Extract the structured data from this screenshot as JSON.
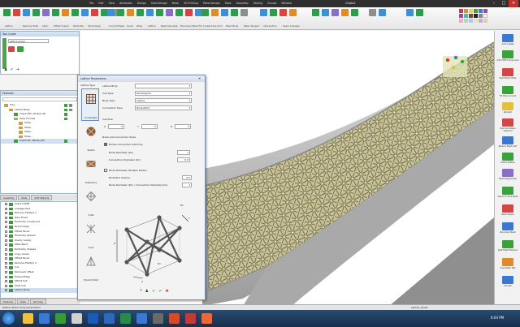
{
  "titlebar": {
    "title": "Chain2",
    "menus": [
      "File",
      "Edit",
      "View",
      "Attributes",
      "Design",
      "Solid Design",
      "Mesh",
      "3D Printing",
      "Metal Design",
      "Tools",
      "Assembly",
      "Tooling",
      "Groups",
      "Window"
    ]
  },
  "tool_guide": {
    "title": "Tool Guide",
    "selector": "Lattice Group"
  },
  "features": {
    "title": "Features",
    "search_placeholder": "Search",
    "items": [
      {
        "label": "Tray",
        "level": 0
      },
      {
        "label": "Lattice Body",
        "level": 1
      },
      {
        "label": "Import BT...Part(s) 3D",
        "level": 2
      },
      {
        "label": "Tube Formed",
        "level": 2
      },
      {
        "label": "Shap...",
        "level": 3
      },
      {
        "label": "Shap...",
        "level": 3
      },
      {
        "label": "Shap...",
        "level": 3
      },
      {
        "label": "Shap...",
        "level": 3
      },
      {
        "label": "Import B...Part(s) 3D",
        "level": 2
      }
    ]
  },
  "panel_tabs": [
    "Assembly",
    "Parts",
    "DOF Wizards"
  ],
  "history": {
    "items": [
      "Import STEP",
      "Lossage Part",
      "Remove Fillet(s) 1",
      "Tube Fixed",
      "Distinctly Conserved",
      "Round edge",
      "Offset Faces",
      "Distinctly Shared",
      "Overly Sub(s)",
      "Plate Bend",
      "Distinctly Shaped",
      "Copy Linear",
      "Offset Faces",
      "Remove Fillet(s) 3",
      "Cut",
      "Removed offset",
      "Extend Edge",
      "Offset Sub",
      "Shell Out",
      "Lattice Body"
    ],
    "tabs": [
      "Features",
      "Data",
      "Set View"
    ]
  },
  "ribbon": {
    "group_labels": [
      "Lattice",
      "Remove Shell",
      "Shell",
      "Offset Scaled",
      "Perforate",
      "Shrinkwrap",
      "Bridge Tool",
      "Extend Edge",
      "Stitch Convert",
      "Flatten",
      "Distance Fit",
      "Measure Tool",
      "Convert Mesh",
      "Quick",
      "Wrap",
      "Lattice",
      "Mesh Visualize",
      "Boundary Mesh Fill",
      "Create Free-form",
      "Mesh Body",
      "Make Tangent",
      "Intersection",
      "Seam Collapse"
    ]
  },
  "dialog": {
    "title": "Lattice Parameters",
    "section_label": "Lattice Type",
    "types": [
      "Uni Strutted",
      "Stretch",
      "Octahedron",
      "Octet",
      "Cross",
      "Pyramid Octet"
    ],
    "fields": [
      {
        "label": "Lattice Body",
        "value": ""
      },
      {
        "label": "Cell Type",
        "value": "Rectangular"
      },
      {
        "label": "Body Type",
        "value": "Lattice"
      },
      {
        "label": "Connection Type",
        "value": "Node/Strut"
      }
    ],
    "cell_size": {
      "label": "Cell Size",
      "x_label": "X",
      "x": "5",
      "y_label": "Y",
      "y": "5",
      "z_label": "Z",
      "z": "5"
    },
    "node_section": "Node and Connection Sizes",
    "node_check_label": "Nodes Connected Uniformly",
    "node_diameter_label": "Node Diameter (Dn)",
    "node_diameter": "1",
    "conn_diameter_label": "Connection Diameter (Dc)",
    "conn_diameter": "0.5",
    "surface_check_label": "Node Diameter Variable Radius",
    "half_label": "Node/Full Volume",
    "half_value": "0.5",
    "ratio_label": "Node Diameter (Dn) / Connection Diameter (Dc)",
    "ratio_value": "1",
    "diagram_labels": {
      "d1": "Dn",
      "d2": "Dc",
      "x": "X",
      "y": "Y",
      "z": "Z"
    }
  },
  "right_toolbar": {
    "labels": [
      "Auto Create",
      "Add STEP Component",
      "Shell Body Utility",
      "Fill Hole Convert",
      "Remesh",
      "Remove Spikes Selected",
      "Reduce Mesh Surf",
      "Lattice Pattern",
      "Mesh Regenerate",
      "Select Tri Face Mesh",
      "Mesh Repair",
      "Boundary Mesh",
      "Split Mesh Element",
      "Save Mesh Plat",
      "Smooth"
    ]
  },
  "status": {
    "left": "Define lattice body parameters",
    "right": "Lattice_shell1"
  },
  "taskbar": {
    "time": "6:04 PM"
  },
  "colors": {
    "ribbon_bg": "#efefef",
    "dialog_bg": "#f3f3f3",
    "accent_green": "#3aa23a",
    "lattice_fill": "#c8c296",
    "taskbar": "#1f3a5c"
  }
}
